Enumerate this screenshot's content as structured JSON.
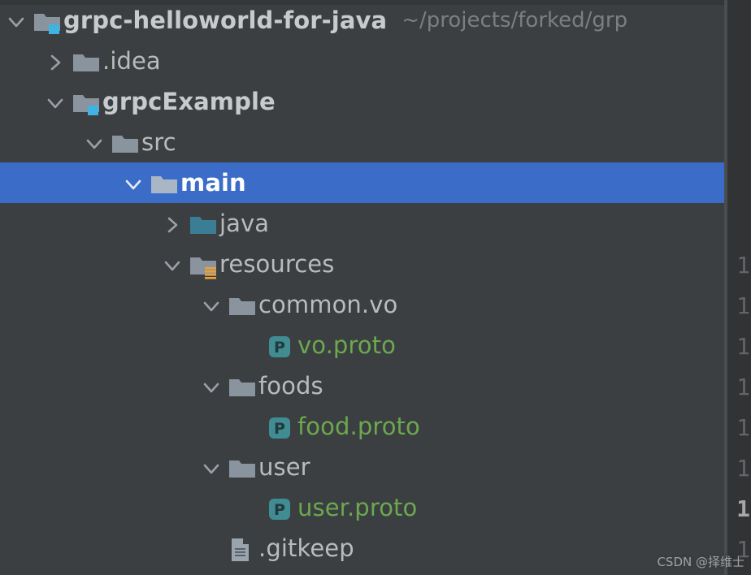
{
  "panel": {
    "name": "project-tree",
    "background": "#3c3f41",
    "selection_color": "#3b6dc8"
  },
  "tree": {
    "rows": [
      {
        "label": "grpc-helloworld-for-java",
        "path_hint": "~/projects/forked/grp",
        "icon": "module-folder-icon",
        "chevron": "chevron-down-icon",
        "indent": 0,
        "bold": true,
        "selected": false,
        "text_color": "#c8cbcd"
      },
      {
        "label": ".idea",
        "path_hint": "",
        "icon": "folder-icon",
        "chevron": "chevron-right-icon",
        "indent": 1,
        "bold": false,
        "selected": false,
        "text_color": "#b9bcbe"
      },
      {
        "label": "grpcExample",
        "path_hint": "",
        "icon": "module-folder-icon",
        "chevron": "chevron-down-icon",
        "indent": 1,
        "bold": true,
        "selected": false,
        "text_color": "#c8cbcd"
      },
      {
        "label": "src",
        "path_hint": "",
        "icon": "folder-icon",
        "chevron": "chevron-down-icon",
        "indent": 2,
        "bold": false,
        "selected": false,
        "text_color": "#b9bcbe"
      },
      {
        "label": "main",
        "path_hint": "",
        "icon": "folder-icon-light",
        "chevron": "chevron-down-icon",
        "indent": 3,
        "bold": true,
        "selected": true,
        "text_color": "#ffffff"
      },
      {
        "label": "java",
        "path_hint": "",
        "icon": "source-root-folder-icon",
        "chevron": "chevron-right-icon",
        "indent": 4,
        "bold": false,
        "selected": false,
        "text_color": "#b9bcbe"
      },
      {
        "label": "resources",
        "path_hint": "",
        "icon": "resources-root-folder-icon",
        "chevron": "chevron-down-icon",
        "indent": 4,
        "bold": false,
        "selected": false,
        "text_color": "#b9bcbe"
      },
      {
        "label": "common.vo",
        "path_hint": "",
        "icon": "folder-icon",
        "chevron": "chevron-down-icon",
        "indent": 5,
        "bold": false,
        "selected": false,
        "text_color": "#b9bcbe"
      },
      {
        "label": "vo.proto",
        "path_hint": "",
        "icon": "proto-file-icon",
        "chevron": "none",
        "indent": 6,
        "bold": false,
        "selected": false,
        "text_color": "#6ba84f"
      },
      {
        "label": "foods",
        "path_hint": "",
        "icon": "folder-icon",
        "chevron": "chevron-down-icon",
        "indent": 5,
        "bold": false,
        "selected": false,
        "text_color": "#b9bcbe"
      },
      {
        "label": "food.proto",
        "path_hint": "",
        "icon": "proto-file-icon",
        "chevron": "none",
        "indent": 6,
        "bold": false,
        "selected": false,
        "text_color": "#6ba84f"
      },
      {
        "label": "user",
        "path_hint": "",
        "icon": "folder-icon",
        "chevron": "chevron-down-icon",
        "indent": 5,
        "bold": false,
        "selected": false,
        "text_color": "#b9bcbe"
      },
      {
        "label": "user.proto",
        "path_hint": "",
        "icon": "proto-file-icon",
        "chevron": "none",
        "indent": 6,
        "bold": false,
        "selected": false,
        "text_color": "#6ba84f"
      },
      {
        "label": ".gitkeep",
        "path_hint": "",
        "icon": "text-file-icon",
        "chevron": "none",
        "indent": 5,
        "bold": false,
        "selected": false,
        "text_color": "#b9bcbe"
      }
    ]
  },
  "proto_icon": {
    "letter": "P"
  },
  "gutter": {
    "lines": [
      {
        "number": "1",
        "current": false
      },
      {
        "number": "1",
        "current": false
      },
      {
        "number": "1",
        "current": false
      },
      {
        "number": "1",
        "current": false
      },
      {
        "number": "1",
        "current": false
      },
      {
        "number": "1",
        "current": false
      },
      {
        "number": "1",
        "current": true
      },
      {
        "number": "1",
        "current": false
      }
    ]
  },
  "watermark": {
    "text": "CSDN @择维士"
  }
}
